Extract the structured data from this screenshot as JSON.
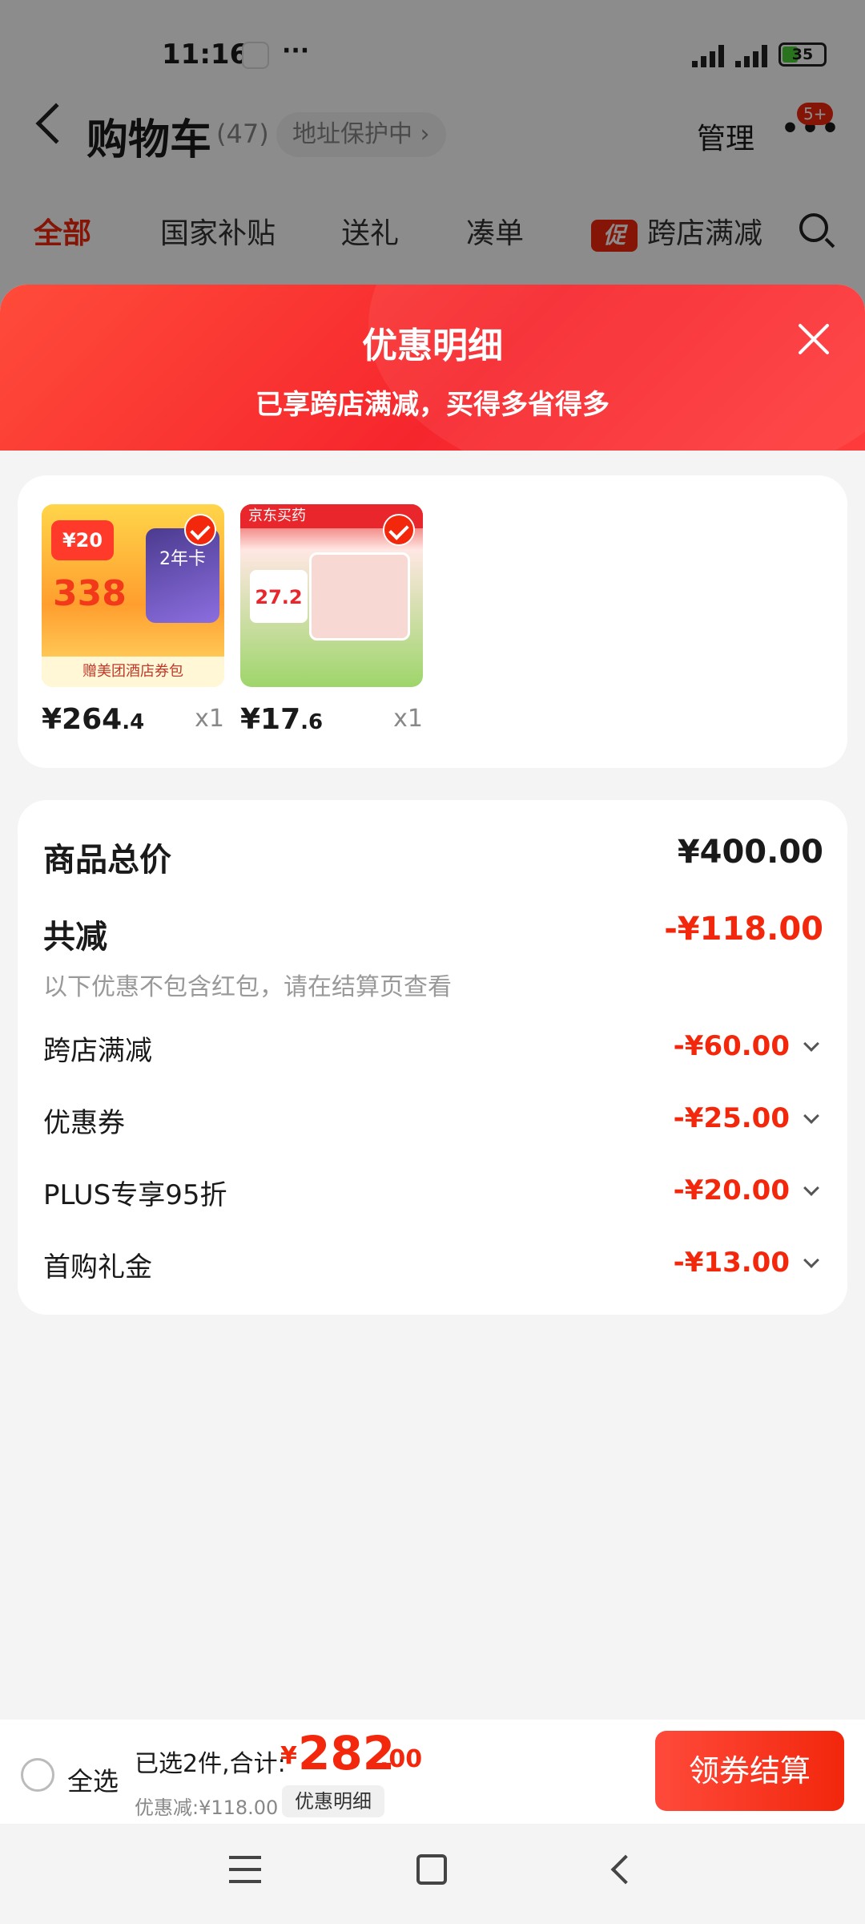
{
  "status_bar": {
    "time": "11:16",
    "dots": "···",
    "battery": "35"
  },
  "header": {
    "title": "购物车",
    "count": "(47)",
    "address": "地址保护中 ›",
    "manage": "管理",
    "badge": "5+"
  },
  "tabs": [
    {
      "label": "全部"
    },
    {
      "label": "国家补贴"
    },
    {
      "label": "送礼"
    },
    {
      "label": "凑单"
    },
    {
      "label": "跨店满减",
      "icon": "促"
    }
  ],
  "sheet": {
    "title": "优惠明细",
    "subtitle": "已享跨店满减，买得多省得多",
    "products": [
      {
        "price_int": "¥264",
        "price_dec": ".4",
        "qty": "x1",
        "thumb_label_a": "¥20",
        "thumb_label_b": "338",
        "thumb_card": "2年卡",
        "thumb_footer": "赠美团酒店券包"
      },
      {
        "price_int": "¥17",
        "price_dec": ".6",
        "qty": "x1",
        "thumb_top": "京东买药",
        "thumb_price": "27.2"
      }
    ],
    "total_label": "商品总价",
    "total_value": "¥400.00",
    "reduce_label": "共减",
    "reduce_value": "-¥118.00",
    "note": "以下优惠不包含红包，请在结算页查看",
    "discounts": [
      {
        "label": "跨店满减",
        "value": "-¥60.00"
      },
      {
        "label": "优惠券",
        "value": "-¥25.00"
      },
      {
        "label": "PLUS专享95折",
        "value": "-¥20.00"
      },
      {
        "label": "首购礼金",
        "value": "-¥13.00"
      }
    ]
  },
  "bottom_bar": {
    "select_all": "全选",
    "chosen": "已选2件,合计:",
    "total_symbol": "¥",
    "total_int": "282",
    "total_dec": ".00",
    "saved": "优惠减:¥118.00",
    "detail_btn": "优惠明细",
    "checkout": "领券结算"
  },
  "colors": {
    "accent": "#f2270c",
    "sheet_bg": "#f4f4f4"
  }
}
